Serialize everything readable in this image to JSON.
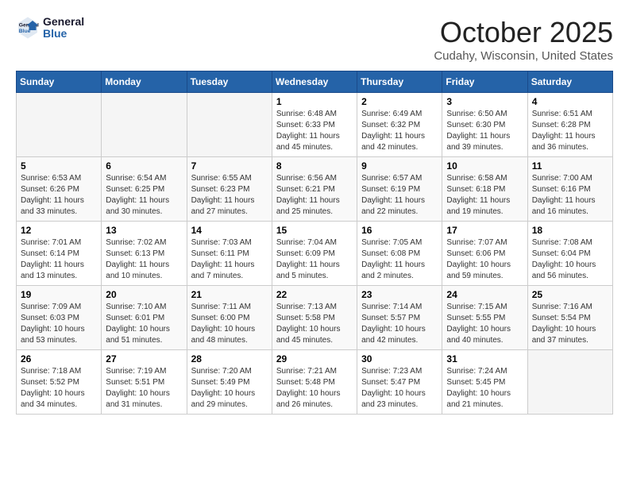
{
  "header": {
    "logo_line1": "General",
    "logo_line2": "Blue",
    "month": "October 2025",
    "location": "Cudahy, Wisconsin, United States"
  },
  "weekdays": [
    "Sunday",
    "Monday",
    "Tuesday",
    "Wednesday",
    "Thursday",
    "Friday",
    "Saturday"
  ],
  "weeks": [
    [
      {
        "day": "",
        "info": ""
      },
      {
        "day": "",
        "info": ""
      },
      {
        "day": "",
        "info": ""
      },
      {
        "day": "1",
        "info": "Sunrise: 6:48 AM\nSunset: 6:33 PM\nDaylight: 11 hours\nand 45 minutes."
      },
      {
        "day": "2",
        "info": "Sunrise: 6:49 AM\nSunset: 6:32 PM\nDaylight: 11 hours\nand 42 minutes."
      },
      {
        "day": "3",
        "info": "Sunrise: 6:50 AM\nSunset: 6:30 PM\nDaylight: 11 hours\nand 39 minutes."
      },
      {
        "day": "4",
        "info": "Sunrise: 6:51 AM\nSunset: 6:28 PM\nDaylight: 11 hours\nand 36 minutes."
      }
    ],
    [
      {
        "day": "5",
        "info": "Sunrise: 6:53 AM\nSunset: 6:26 PM\nDaylight: 11 hours\nand 33 minutes."
      },
      {
        "day": "6",
        "info": "Sunrise: 6:54 AM\nSunset: 6:25 PM\nDaylight: 11 hours\nand 30 minutes."
      },
      {
        "day": "7",
        "info": "Sunrise: 6:55 AM\nSunset: 6:23 PM\nDaylight: 11 hours\nand 27 minutes."
      },
      {
        "day": "8",
        "info": "Sunrise: 6:56 AM\nSunset: 6:21 PM\nDaylight: 11 hours\nand 25 minutes."
      },
      {
        "day": "9",
        "info": "Sunrise: 6:57 AM\nSunset: 6:19 PM\nDaylight: 11 hours\nand 22 minutes."
      },
      {
        "day": "10",
        "info": "Sunrise: 6:58 AM\nSunset: 6:18 PM\nDaylight: 11 hours\nand 19 minutes."
      },
      {
        "day": "11",
        "info": "Sunrise: 7:00 AM\nSunset: 6:16 PM\nDaylight: 11 hours\nand 16 minutes."
      }
    ],
    [
      {
        "day": "12",
        "info": "Sunrise: 7:01 AM\nSunset: 6:14 PM\nDaylight: 11 hours\nand 13 minutes."
      },
      {
        "day": "13",
        "info": "Sunrise: 7:02 AM\nSunset: 6:13 PM\nDaylight: 11 hours\nand 10 minutes."
      },
      {
        "day": "14",
        "info": "Sunrise: 7:03 AM\nSunset: 6:11 PM\nDaylight: 11 hours\nand 7 minutes."
      },
      {
        "day": "15",
        "info": "Sunrise: 7:04 AM\nSunset: 6:09 PM\nDaylight: 11 hours\nand 5 minutes."
      },
      {
        "day": "16",
        "info": "Sunrise: 7:05 AM\nSunset: 6:08 PM\nDaylight: 11 hours\nand 2 minutes."
      },
      {
        "day": "17",
        "info": "Sunrise: 7:07 AM\nSunset: 6:06 PM\nDaylight: 10 hours\nand 59 minutes."
      },
      {
        "day": "18",
        "info": "Sunrise: 7:08 AM\nSunset: 6:04 PM\nDaylight: 10 hours\nand 56 minutes."
      }
    ],
    [
      {
        "day": "19",
        "info": "Sunrise: 7:09 AM\nSunset: 6:03 PM\nDaylight: 10 hours\nand 53 minutes."
      },
      {
        "day": "20",
        "info": "Sunrise: 7:10 AM\nSunset: 6:01 PM\nDaylight: 10 hours\nand 51 minutes."
      },
      {
        "day": "21",
        "info": "Sunrise: 7:11 AM\nSunset: 6:00 PM\nDaylight: 10 hours\nand 48 minutes."
      },
      {
        "day": "22",
        "info": "Sunrise: 7:13 AM\nSunset: 5:58 PM\nDaylight: 10 hours\nand 45 minutes."
      },
      {
        "day": "23",
        "info": "Sunrise: 7:14 AM\nSunset: 5:57 PM\nDaylight: 10 hours\nand 42 minutes."
      },
      {
        "day": "24",
        "info": "Sunrise: 7:15 AM\nSunset: 5:55 PM\nDaylight: 10 hours\nand 40 minutes."
      },
      {
        "day": "25",
        "info": "Sunrise: 7:16 AM\nSunset: 5:54 PM\nDaylight: 10 hours\nand 37 minutes."
      }
    ],
    [
      {
        "day": "26",
        "info": "Sunrise: 7:18 AM\nSunset: 5:52 PM\nDaylight: 10 hours\nand 34 minutes."
      },
      {
        "day": "27",
        "info": "Sunrise: 7:19 AM\nSunset: 5:51 PM\nDaylight: 10 hours\nand 31 minutes."
      },
      {
        "day": "28",
        "info": "Sunrise: 7:20 AM\nSunset: 5:49 PM\nDaylight: 10 hours\nand 29 minutes."
      },
      {
        "day": "29",
        "info": "Sunrise: 7:21 AM\nSunset: 5:48 PM\nDaylight: 10 hours\nand 26 minutes."
      },
      {
        "day": "30",
        "info": "Sunrise: 7:23 AM\nSunset: 5:47 PM\nDaylight: 10 hours\nand 23 minutes."
      },
      {
        "day": "31",
        "info": "Sunrise: 7:24 AM\nSunset: 5:45 PM\nDaylight: 10 hours\nand 21 minutes."
      },
      {
        "day": "",
        "info": ""
      }
    ]
  ]
}
